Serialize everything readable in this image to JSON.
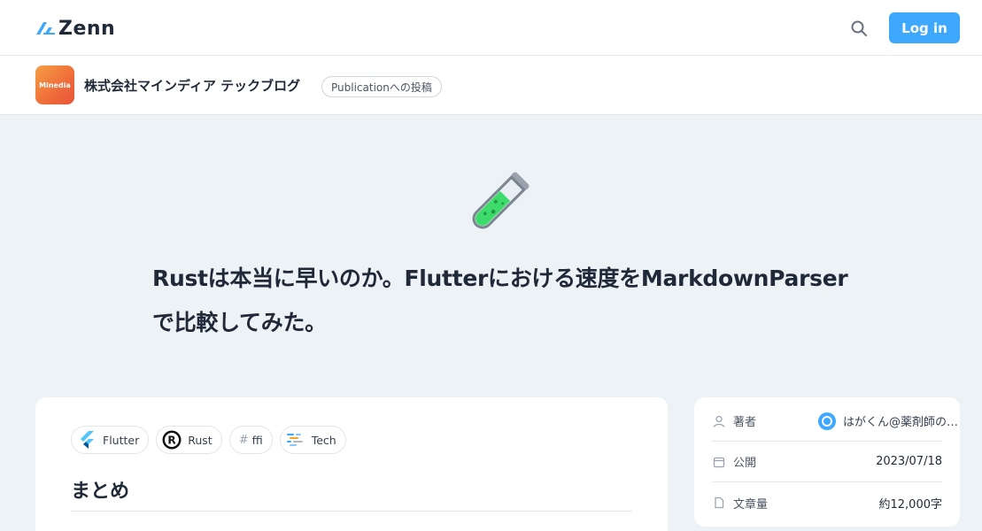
{
  "header": {
    "logo_text": "Zenn",
    "login_label": "Log in",
    "search_icon": "search-icon",
    "accent_color": "#3ea8ff"
  },
  "publication": {
    "avatar_text": "Minedia",
    "name": "株式会社マインディア テックブログ",
    "badge": "Publicationへの投稿"
  },
  "article": {
    "emoji": "test-tube-icon",
    "title_line1": "Rustは本当に早いのか。Flutterにおける速度をMarkdownParser",
    "title_line2": "で比較してみた。",
    "topics": [
      {
        "label": "Flutter",
        "icon": "flutter-icon"
      },
      {
        "label": "Rust",
        "icon": "rust-icon"
      },
      {
        "label": "ffi",
        "icon": "hash-icon"
      },
      {
        "label": "Tech",
        "icon": "tech-icon"
      }
    ],
    "section_heading": "まとめ"
  },
  "sidebar": {
    "author_label": "著者",
    "author_name": "はがくん@薬剤師の…",
    "published_label": "公開",
    "published_date": "2023/07/18",
    "wordcount_label": "文章量",
    "wordcount_value": "約12,000字"
  }
}
